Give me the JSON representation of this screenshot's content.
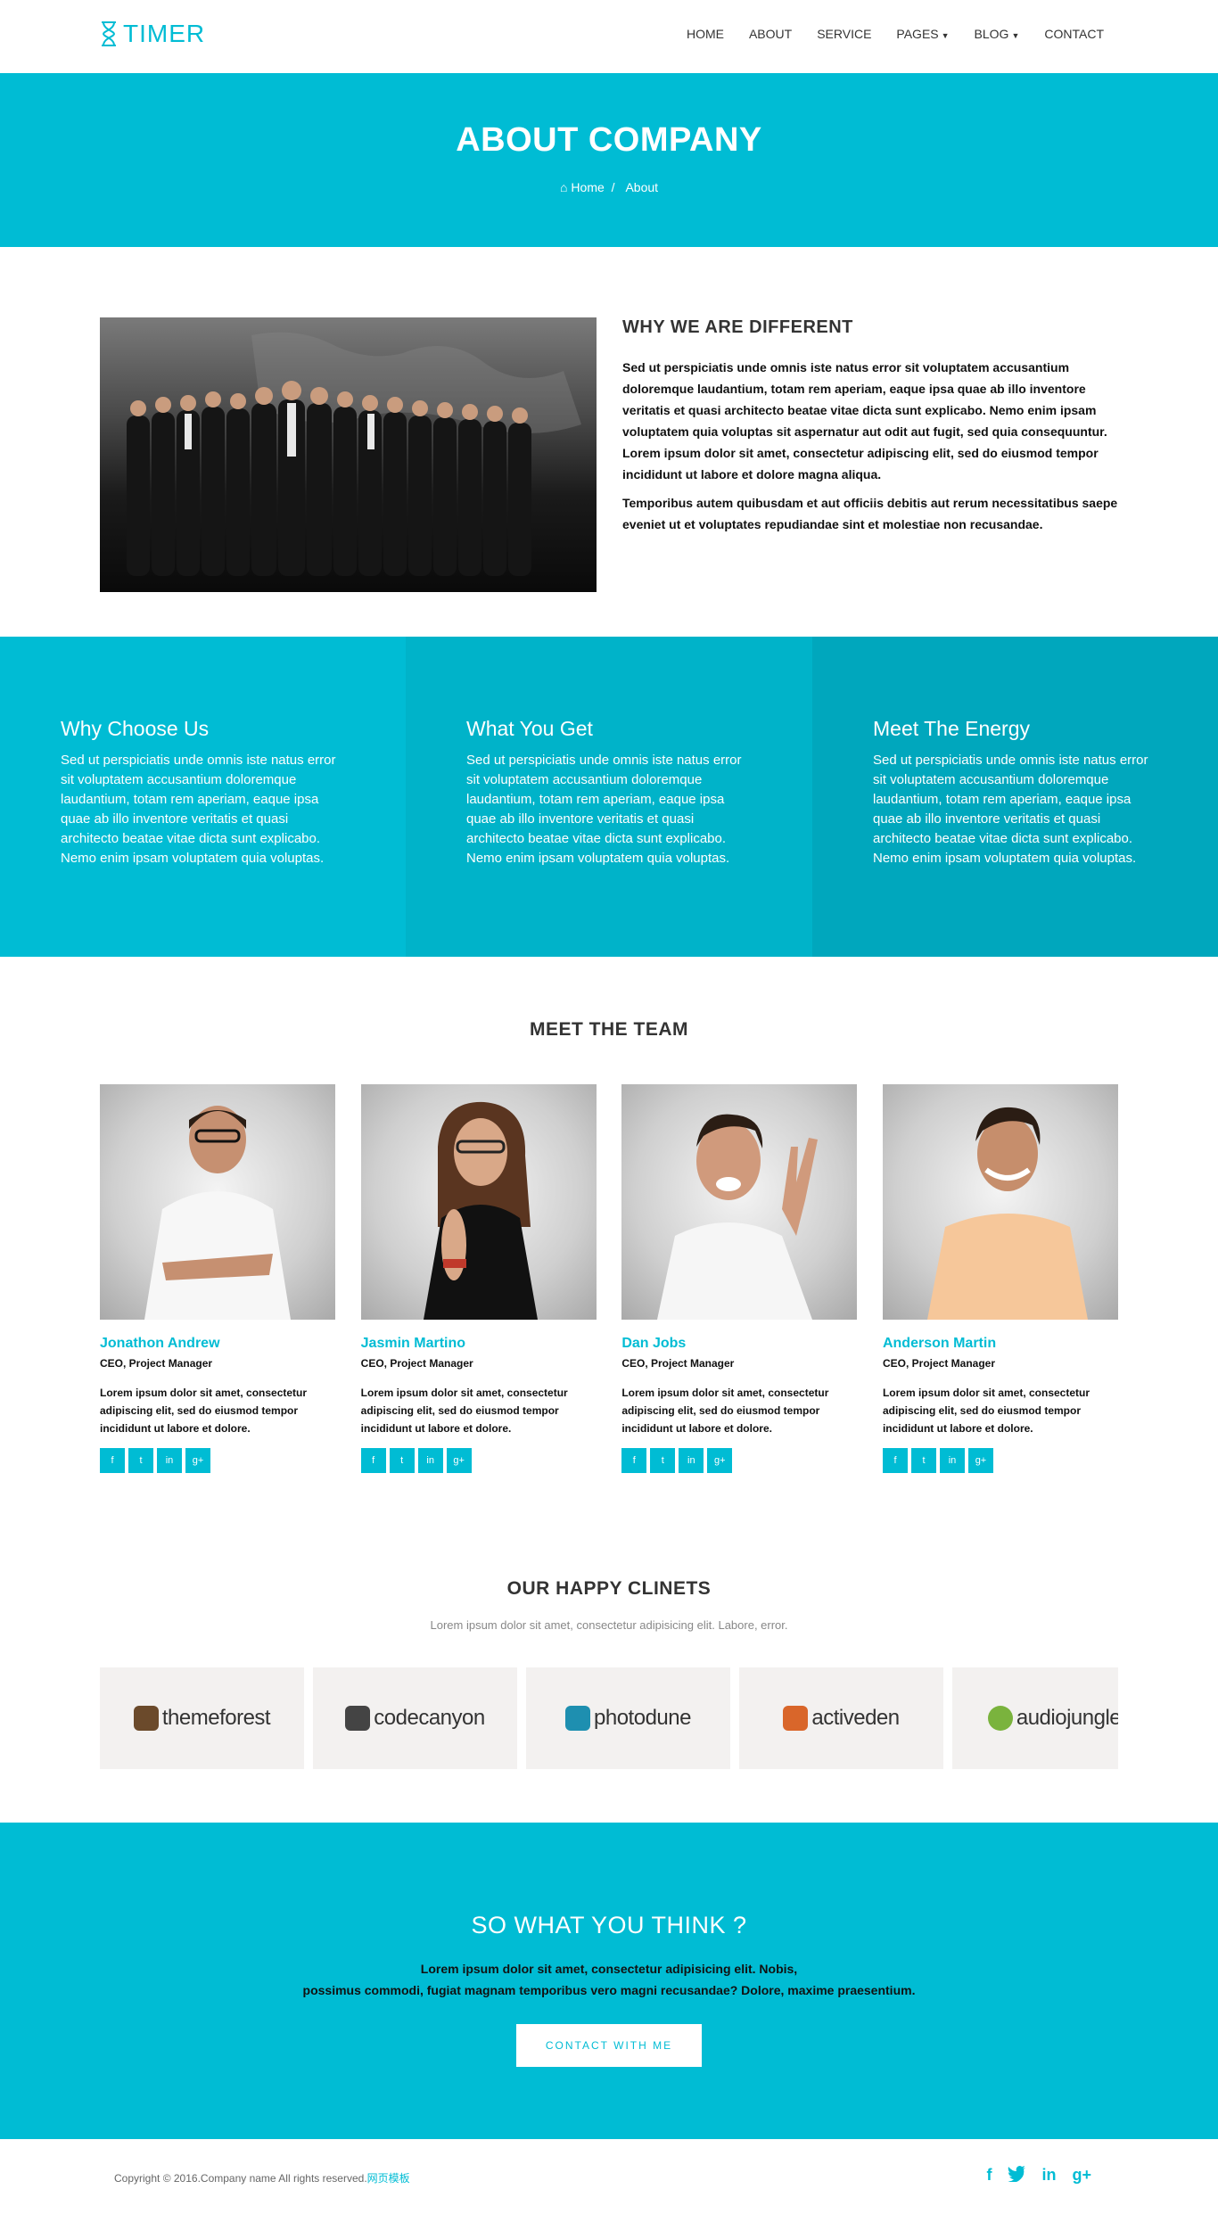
{
  "header": {
    "logo_text": "TIMER",
    "nav": [
      {
        "label": "HOME",
        "caret": false
      },
      {
        "label": "ABOUT",
        "caret": false
      },
      {
        "label": "SERVICE",
        "caret": false
      },
      {
        "label": "PAGES",
        "caret": true
      },
      {
        "label": "BLOG",
        "caret": true
      },
      {
        "label": "CONTACT",
        "caret": false
      }
    ]
  },
  "banner": {
    "title": "ABOUT COMPANY",
    "breadcrumb_home": "Home",
    "breadcrumb_sep": "/",
    "breadcrumb_current": "About"
  },
  "about": {
    "title": "WHY WE ARE DIFFERENT",
    "para1": "Sed ut perspiciatis unde omnis iste natus error sit voluptatem accusantium doloremque laudantium, totam rem aperiam, eaque ipsa quae ab illo inventore veritatis et quasi architecto beatae vitae dicta sunt explicabo. Nemo enim ipsam voluptatem quia voluptas sit aspernatur aut odit aut fugit, sed quia consequuntur. Lorem ipsum dolor sit amet, consectetur adipiscing elit, sed do eiusmod tempor incididunt ut labore et dolore magna aliqua.",
    "para2": "Temporibus autem quibusdam et aut officiis debitis aut rerum necessitatibus saepe eveniet ut et voluptates repudiandae sint et molestiae non recusandae."
  },
  "features": [
    {
      "title": "Why Choose Us",
      "text": "Sed ut perspiciatis unde omnis iste natus error sit voluptatem accusantium doloremque laudantium, totam rem aperiam, eaque ipsa quae ab illo inventore veritatis et quasi architecto beatae vitae dicta sunt explicabo. Nemo enim ipsam voluptatem quia voluptas."
    },
    {
      "title": "What You Get",
      "text": "Sed ut perspiciatis unde omnis iste natus error sit voluptatem accusantium doloremque laudantium, totam rem aperiam, eaque ipsa quae ab illo inventore veritatis et quasi architecto beatae vitae dicta sunt explicabo. Nemo enim ipsam voluptatem quia voluptas."
    },
    {
      "title": "Meet The Energy",
      "text": "Sed ut perspiciatis unde omnis iste natus error sit voluptatem accusantium doloremque laudantium, totam rem aperiam, eaque ipsa quae ab illo inventore veritatis et quasi architecto beatae vitae dicta sunt explicabo. Nemo enim ipsam voluptatem quia voluptas."
    }
  ],
  "team": {
    "title": "MEET THE TEAM",
    "members": [
      {
        "name": "Jonathon Andrew",
        "role": "CEO, Project Manager",
        "bio": "Lorem ipsum dolor sit amet, consectetur adipiscing elit, sed do eiusmod tempor incididunt ut labore et dolore."
      },
      {
        "name": "Jasmin Martino",
        "role": "CEO, Project Manager",
        "bio": "Lorem ipsum dolor sit amet, consectetur adipiscing elit, sed do eiusmod tempor incididunt ut labore et dolore."
      },
      {
        "name": "Dan Jobs",
        "role": "CEO, Project Manager",
        "bio": "Lorem ipsum dolor sit amet, consectetur adipiscing elit, sed do eiusmod tempor incididunt ut labore et dolore."
      },
      {
        "name": "Anderson Martin",
        "role": "CEO, Project Manager",
        "bio": "Lorem ipsum dolor sit amet, consectetur adipiscing elit, sed do eiusmod tempor incididunt ut labore et dolore."
      }
    ],
    "social": [
      "f",
      "t",
      "in",
      "g+"
    ]
  },
  "clients": {
    "title": "OUR HAPPY CLINETS",
    "subtitle": "Lorem ipsum dolor sit amet, consectetur adipisicing elit. Labore, error.",
    "logos": [
      {
        "name": "themeforest",
        "color": "#6b4a2b"
      },
      {
        "name": "codecanyon",
        "color": "#444444"
      },
      {
        "name": "photodune",
        "color": "#1e8fb0"
      },
      {
        "name": "activeden",
        "color": "#d9662a"
      },
      {
        "name": "audiojungle",
        "color": "#7ab33d"
      }
    ]
  },
  "cta": {
    "title": "SO WHAT YOU THINK ?",
    "line1": "Lorem ipsum dolor sit amet, consectetur adipisicing elit. Nobis,",
    "line2": "possimus commodi, fugiat magnam temporibus vero magni recusandae? Dolore, maxime praesentium.",
    "button": "CONTACT WITH ME"
  },
  "footer": {
    "copyright": "Copyright © 2016.Company name All rights reserved.",
    "link": "网页模板",
    "social": [
      "f",
      "twitter",
      "in",
      "g+"
    ]
  },
  "colors": {
    "accent": "#00bcd4"
  }
}
